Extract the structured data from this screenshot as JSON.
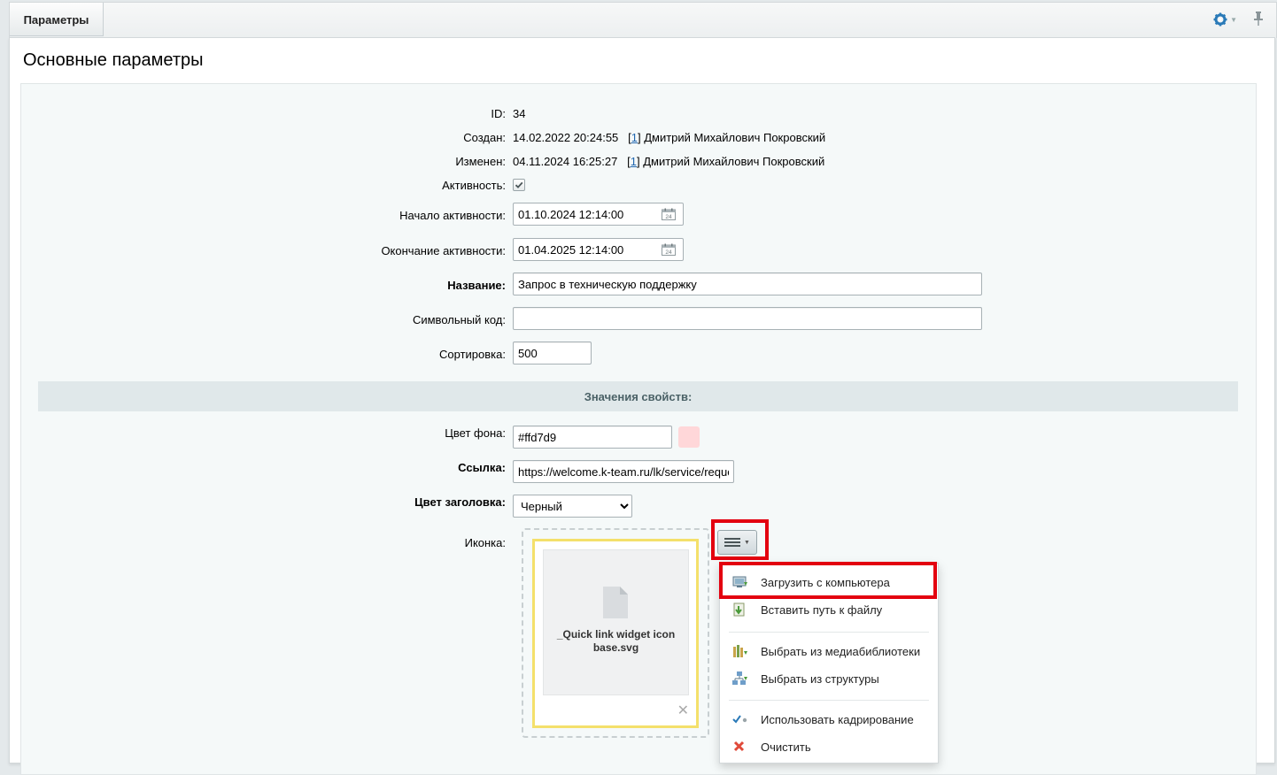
{
  "tabbar": {
    "tab_label": "Параметры"
  },
  "panel": {
    "title": "Основные параметры"
  },
  "fields": {
    "id": {
      "label": "ID:",
      "value": "34"
    },
    "created": {
      "label": "Создан:",
      "date": "14.02.2022 20:24:55",
      "user_id": "1",
      "user_name": "Дмитрий Михайлович Покровский"
    },
    "modified": {
      "label": "Изменен:",
      "date": "04.11.2024 16:25:27",
      "user_id": "1",
      "user_name": "Дмитрий Михайлович Покровский"
    },
    "active": {
      "label": "Активность:",
      "checked": true
    },
    "active_from": {
      "label": "Начало активности:",
      "value": "01.10.2024 12:14:00"
    },
    "active_to": {
      "label": "Окончание активности:",
      "value": "01.04.2025 12:14:00"
    },
    "name": {
      "label": "Название:",
      "value": "Запрос в техническую поддержку"
    },
    "code": {
      "label": "Символьный код:",
      "value": ""
    },
    "sort": {
      "label": "Сортировка:",
      "value": "500"
    }
  },
  "properties": {
    "section_title": "Значения свойств:",
    "bg_color": {
      "label": "Цвет фона:",
      "value": "#ffd7d9",
      "swatch": "#ffd7d9"
    },
    "link": {
      "label": "Ссылка:",
      "value": "https://welcome.k-team.ru/lk/service/request"
    },
    "title_color": {
      "label": "Цвет заголовка:",
      "selected": "Черный"
    },
    "icon": {
      "label": "Иконка:",
      "file_name_line1": "_Quick link widget icon",
      "file_name_line2": "base.svg"
    }
  },
  "popup_menu": {
    "items": [
      {
        "label": "Загрузить с компьютера",
        "icon": "upload-computer-icon"
      },
      {
        "label": "Вставить путь к файлу",
        "icon": "insert-path-icon"
      },
      {
        "label": "Выбрать из медиабиблиотеки",
        "icon": "medialibrary-icon"
      },
      {
        "label": "Выбрать из структуры",
        "icon": "structure-icon"
      },
      {
        "label": "Использовать кадрирование",
        "icon": "crop-toggle-icon",
        "checked": true
      },
      {
        "label": "Очистить",
        "icon": "clear-icon"
      }
    ]
  },
  "colors": {
    "accent_blue": "#2067b0",
    "highlight_red": "#e3000f",
    "section_bar": "#e0e8ea",
    "file_border": "#f4e06b"
  }
}
